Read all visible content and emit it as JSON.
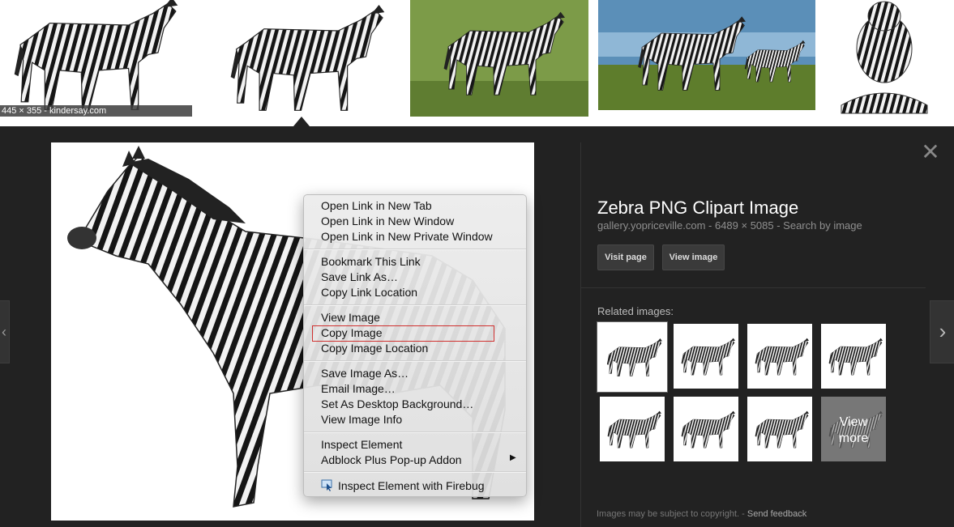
{
  "top_strip": {
    "thumbnail_caption": "445 × 355 - kindersay.com"
  },
  "panel": {
    "title": "Zebra PNG Clipart Image",
    "meta": "gallery.yopriceville.com - 6489 × 5085 - Search by image",
    "buttons": {
      "visit_page": "Visit page",
      "view_image": "View image"
    },
    "related_label": "Related images:",
    "view_more": [
      "View",
      "more"
    ],
    "footer": {
      "notice": "Images may be subject to copyright.",
      "separator": " - ",
      "feedback": "Send feedback"
    }
  },
  "context_menu": {
    "groups": [
      [
        "Open Link in New Tab",
        "Open Link in New Window",
        "Open Link in New Private Window"
      ],
      [
        "Bookmark This Link",
        "Save Link As…",
        "Copy Link Location"
      ],
      [
        "View Image",
        "Copy Image",
        "Copy Image Location"
      ],
      [
        "Save Image As…",
        "Email Image…",
        "Set As Desktop Background…",
        "View Image Info"
      ],
      [
        "Inspect Element",
        "Adblock Plus Pop-up Addon"
      ],
      [
        "Inspect Element with Firebug"
      ]
    ],
    "highlighted_item": "Copy Image",
    "highlight_color": "#d0302f",
    "submenu_arrow": "▶"
  },
  "icons": {
    "close": "close-icon",
    "prev": "chevron-left-icon",
    "next": "chevron-right-icon",
    "firebug": "firebug-icon"
  },
  "glyphs": {
    "close": "✕",
    "prev": "‹",
    "next": "›"
  }
}
